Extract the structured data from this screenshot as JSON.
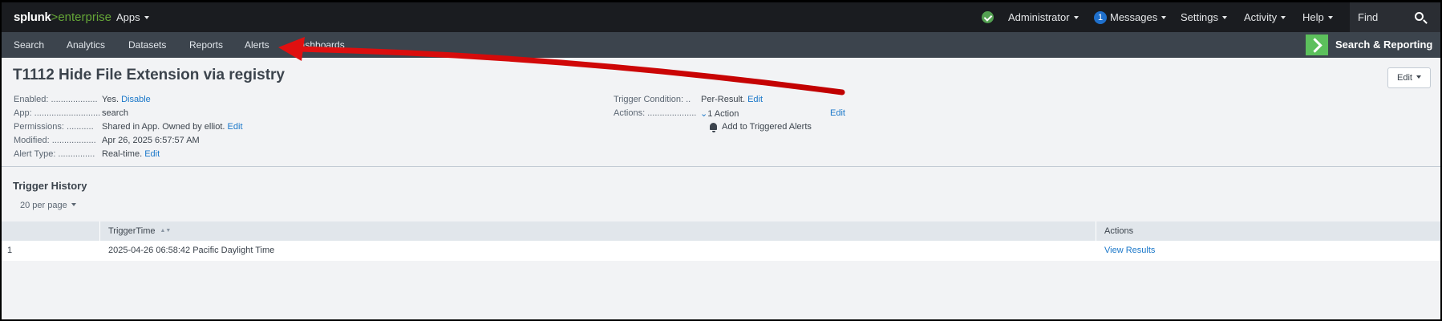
{
  "topbar": {
    "logo_splunk": "splunk",
    "logo_gt": ">",
    "logo_enterprise": "enterprise",
    "apps_label": "Apps",
    "user_label": "Administrator",
    "messages_count": "1",
    "messages_label": "Messages",
    "settings_label": "Settings",
    "activity_label": "Activity",
    "help_label": "Help",
    "find_label": "Find",
    "status_icon": "check-circle-icon"
  },
  "appbar": {
    "nav": [
      "Search",
      "Analytics",
      "Datasets",
      "Reports",
      "Alerts",
      "Dashboards"
    ],
    "app_title": "Search & Reporting",
    "app_logo_color": "#5cc05c"
  },
  "alert": {
    "title": "T1112 Hide File Extension via registry",
    "edit_button": "Edit",
    "enabled_label": "Enabled: ...................",
    "enabled_value": "Yes.",
    "enabled_action": "Disable",
    "app_label": "App: ...........................",
    "app_value": "search",
    "permissions_label": "Permissions: ...........",
    "permissions_value": "Shared in App. Owned by elliot.",
    "permissions_action": "Edit",
    "modified_label": "Modified: ..................",
    "modified_value": "Apr 26, 2025 6:57:57 AM",
    "alert_type_label": "Alert Type: ...............",
    "alert_type_value": "Real-time.",
    "alert_type_action": "Edit",
    "trigger_condition_label": "Trigger Condition: ..",
    "trigger_condition_value": "Per-Result.",
    "trigger_condition_action": "Edit",
    "actions_label": "Actions: ....................",
    "actions_value": "1 Action",
    "actions_action": "Edit",
    "action_item": "Add to Triggered Alerts"
  },
  "trigger_history": {
    "title": "Trigger History",
    "per_page": "20 per page",
    "columns": [
      "TriggerTime",
      "Actions"
    ],
    "rows": [
      {
        "index": "1",
        "time": "2025-04-26 06:58:42 Pacific Daylight Time",
        "action": "View Results"
      }
    ]
  },
  "colors": {
    "topbar_bg": "#1a1c20",
    "appbar_bg": "#3c444d",
    "link": "#1a77c9",
    "brand_green": "#65a637",
    "annotation_arrow": "#e01010"
  }
}
